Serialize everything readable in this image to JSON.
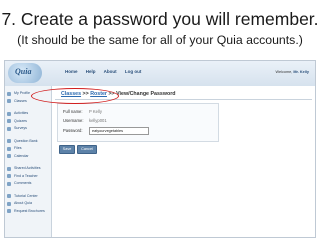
{
  "slide": {
    "title": "7. Create a password you will remember.",
    "subtitle": "(It should be the same for all of your Quia accounts.)"
  },
  "app": {
    "logo_text": "Quia",
    "nav": [
      "Home",
      "Help",
      "About",
      "Log out"
    ],
    "welcome_label": "Welcome,",
    "welcome_user": "Mr. Kelly"
  },
  "sidebar": {
    "items": [
      {
        "label": "My Profile",
        "icon": "user-icon"
      },
      {
        "label": "Classes",
        "icon": "classes-icon"
      },
      {
        "label": "Activities",
        "icon": "activities-icon"
      },
      {
        "label": "Quizzes",
        "icon": "quizzes-icon"
      },
      {
        "label": "Surveys",
        "icon": "surveys-icon"
      },
      {
        "label": "Question Bank",
        "icon": "question-bank-icon"
      },
      {
        "label": "Files",
        "icon": "files-icon"
      },
      {
        "label": "Calendar",
        "icon": "calendar-icon"
      },
      {
        "label": "Shared Activities",
        "icon": "shared-icon"
      },
      {
        "label": "Find a Teacher",
        "icon": "find-icon"
      },
      {
        "label": "Comments",
        "icon": "comments-icon"
      },
      {
        "label": "Tutorial Center",
        "icon": "tutorial-icon"
      },
      {
        "label": "About Quia",
        "icon": "info-icon"
      },
      {
        "label": "Request Brochures",
        "icon": "brochure-icon"
      }
    ]
  },
  "breadcrumb": {
    "classes": "Classes",
    "roster": "Roster",
    "current": "View/Change Password",
    "separator": ">>"
  },
  "form": {
    "fullname_label": "Full name:",
    "fullname_value": "P Kelly",
    "username_label": "Username:",
    "username_value": "kellyp001",
    "password_label": "Password:",
    "password_value": "eatyourvegetables",
    "save_label": "Save",
    "cancel_label": "Cancel"
  },
  "colors": {
    "highlight": "#d11d1d",
    "link": "#2a6ab0"
  }
}
